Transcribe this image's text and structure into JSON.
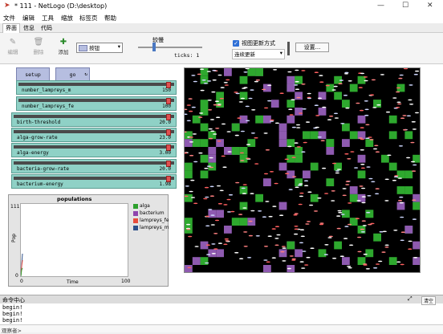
{
  "window": {
    "title": "* 111 - NetLogo (D:\\desktop)",
    "minimize": "—",
    "maximize": "☐",
    "close": "✕"
  },
  "menu": [
    "文件",
    "编辑",
    "工具",
    "缩放",
    "标签页",
    "帮助"
  ],
  "tabs": [
    "界面",
    "信息",
    "代码"
  ],
  "toolbar": {
    "edit": "编辑",
    "delete": "删除",
    "add": "添加",
    "widget_type": "按钮",
    "speed_label": "较慢",
    "ticks_label": "ticks: 1",
    "view_updates_label": "视图更新方式",
    "update_mode": "连续更新",
    "settings": "设置..."
  },
  "buttons": {
    "setup": "setup",
    "go": "go"
  },
  "sliders": [
    {
      "label": "number_lampreys_m",
      "value": "150",
      "fraction": 0.97
    },
    {
      "label": "number_lampreys_fe",
      "value": "100",
      "fraction": 0.97
    },
    {
      "label": "birth-threshold",
      "value": "20.0",
      "fraction": 0.97
    },
    {
      "label": "alga-grow-rate",
      "value": "23.0",
      "fraction": 0.97
    },
    {
      "label": "alga-energy",
      "value": "3.00",
      "fraction": 0.97
    },
    {
      "label": "bacteria-grow-rate",
      "value": "20.0",
      "fraction": 0.97
    },
    {
      "label": "bacterium-energy",
      "value": "1.98",
      "fraction": 0.97
    }
  ],
  "plot": {
    "title": "populations",
    "ylabel": "Pop",
    "xlabel": "Time",
    "ymax": "111",
    "ymin": "0",
    "xmin": "0",
    "xmax": "100",
    "legend": [
      {
        "name": "alga",
        "color": "#2ca02c"
      },
      {
        "name": "bacterium",
        "color": "#8e44ad"
      },
      {
        "name": "lampreys_fe",
        "color": "#e74c3c"
      },
      {
        "name": "lampreys_m",
        "color": "#2c4f8a"
      }
    ]
  },
  "world": {
    "alga_color": "#2ea82e",
    "bacterium_color": "#8e5ab0"
  },
  "command_center": {
    "title": "命令中心",
    "clear": "清空",
    "output": [
      "begin!",
      "begin!",
      "begin!"
    ],
    "prompt": "观察者>"
  }
}
